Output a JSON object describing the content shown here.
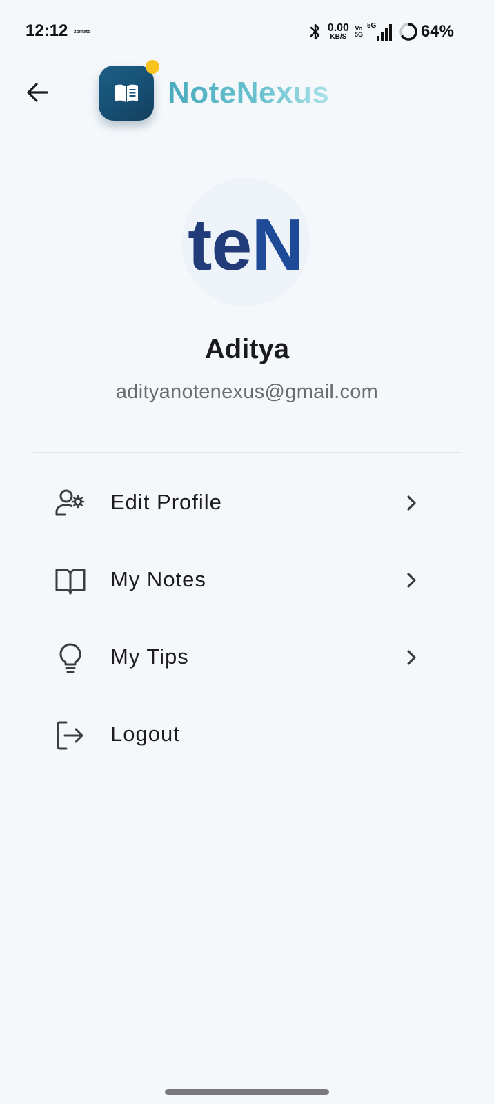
{
  "status_bar": {
    "time": "12:12",
    "notification_app": "zomato",
    "net_speed_value": "0.00",
    "net_speed_unit": "KB/S",
    "volte_top": "Vo",
    "volte_bottom": "5G",
    "signal_type": "5G",
    "battery_percent": "64%"
  },
  "header": {
    "app_title": "NoteNexus",
    "logo_icon": "book-icon",
    "badge_color": "#f7c31c"
  },
  "profile": {
    "avatar_text_dark": "te",
    "avatar_text_blue": "N",
    "name": "Aditya",
    "email": "adityanotenexus@gmail.com"
  },
  "menu": {
    "items": [
      {
        "label": "Edit Profile",
        "icon": "user-settings-icon",
        "has_chevron": true
      },
      {
        "label": "My Notes",
        "icon": "open-book-icon",
        "has_chevron": true
      },
      {
        "label": "My Tips",
        "icon": "lightbulb-icon",
        "has_chevron": true
      },
      {
        "label": "Logout",
        "icon": "logout-icon",
        "has_chevron": false
      }
    ]
  },
  "colors": {
    "background": "#f5f8fb",
    "logo_bg": "#1a5680",
    "title_gradient_start": "#4aabbd",
    "title_gradient_end": "#a9e1e8",
    "avatar_dark": "#223b79",
    "avatar_blue": "#1e4a98"
  }
}
